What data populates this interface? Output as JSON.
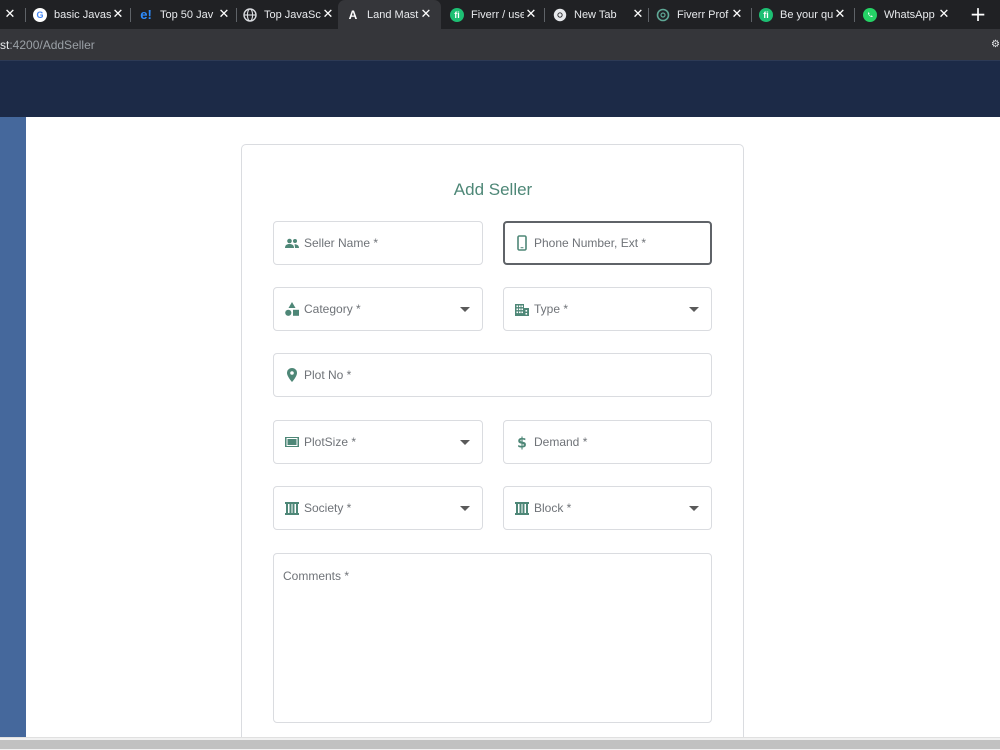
{
  "browser": {
    "tabs": [
      {
        "title": "",
        "favicon": "close-only",
        "active": false
      },
      {
        "title": "basic Javas",
        "favicon": "google-icon",
        "active": false
      },
      {
        "title": "Top 50 Jav",
        "favicon": "edureka-icon",
        "active": false
      },
      {
        "title": "Top JavaSc",
        "favicon": "globe-icon",
        "active": false
      },
      {
        "title": "Land Mast",
        "favicon": "angular-icon",
        "active": true
      },
      {
        "title": "Fiverr / use",
        "favicon": "fiverr-icon",
        "active": false
      },
      {
        "title": "New Tab",
        "favicon": "chrome-icon",
        "active": false
      },
      {
        "title": "Fiverr Prof",
        "favicon": "openai-icon",
        "active": false
      },
      {
        "title": "Be your qu",
        "favicon": "fiverr-icon",
        "active": false
      },
      {
        "title": "WhatsApp",
        "favicon": "whatsapp-icon",
        "active": false
      }
    ],
    "new_tab_label": "+",
    "close_glyph": "✕",
    "url_host": "st",
    "url_rest": ":4200/AddSeller"
  },
  "form": {
    "title": "Add Seller",
    "seller_name": "Seller Name *",
    "phone": "Phone Number, Ext *",
    "category": "Category *",
    "type": "Type *",
    "plot_no": "Plot No *",
    "plot_size": "PlotSize *",
    "demand": "Demand *",
    "society": "Society *",
    "block": "Block *",
    "comments": "Comments *"
  },
  "colors": {
    "accent": "#4e8777",
    "header": "#1c2a47",
    "sidebar": "#45689c"
  }
}
